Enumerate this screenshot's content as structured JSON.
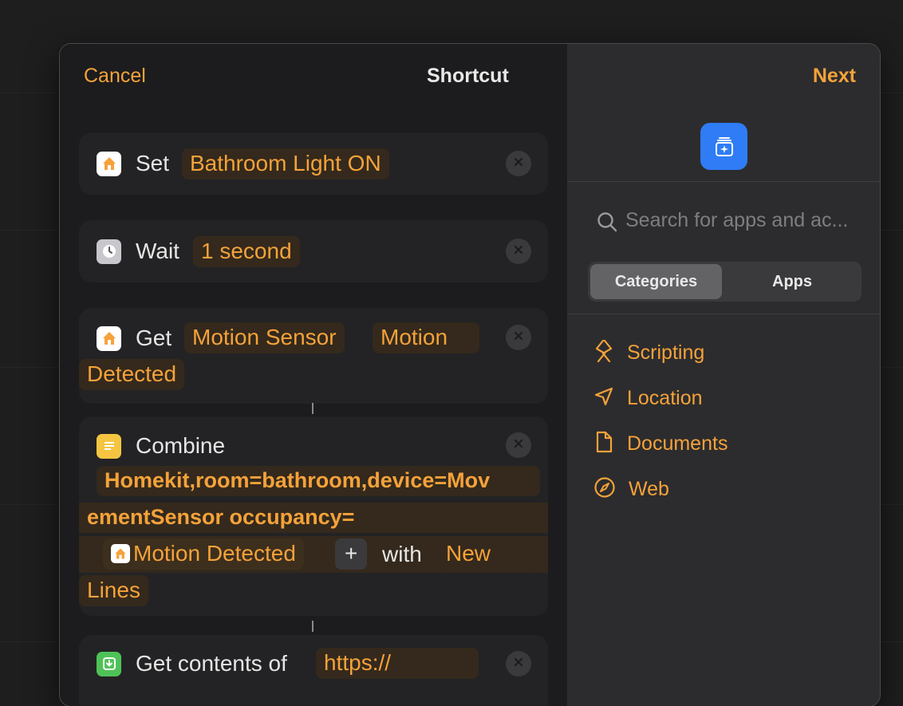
{
  "window": {
    "title": "Shortcut",
    "cancel_label": "Cancel",
    "next_label": "Next"
  },
  "actions": {
    "set": {
      "verb": "Set",
      "param": "Bathroom Light ON",
      "icon": "home-icon"
    },
    "wait": {
      "verb": "Wait",
      "param": "1 second",
      "icon": "clock-icon"
    },
    "get": {
      "verb": "Get",
      "param1": "Motion Sensor",
      "param2_line1": "Motion",
      "param2_line2": "Detected",
      "icon": "home-icon"
    },
    "combine": {
      "verb": "Combine",
      "text_line1": "Homekit,room=bathroom,device=Mov",
      "text_line2": "ementSensor occupancy=",
      "variable": "Motion Detected",
      "plus": "+",
      "with": "with",
      "sep_line1": "New",
      "sep_line2": "Lines",
      "icon": "text-icon"
    },
    "get_contents": {
      "verb": "Get contents of",
      "param": "https://",
      "icon": "download-icon"
    }
  },
  "sidebar": {
    "search_placeholder": "Search for apps and ac...",
    "tabs": [
      "Categories",
      "Apps"
    ],
    "active_tab": "Categories",
    "categories": [
      {
        "label": "Scripting",
        "icon": "scripting-icon"
      },
      {
        "label": "Location",
        "icon": "location-arrow-icon"
      },
      {
        "label": "Documents",
        "icon": "document-icon"
      },
      {
        "label": "Web",
        "icon": "compass-icon"
      }
    ]
  },
  "colors": {
    "accent": "#f5a23a",
    "token_bg": "#34291c",
    "panel": "#2c2c2e",
    "editor": "#1c1c1e",
    "shortcut_icon": "#2f7cf6"
  }
}
